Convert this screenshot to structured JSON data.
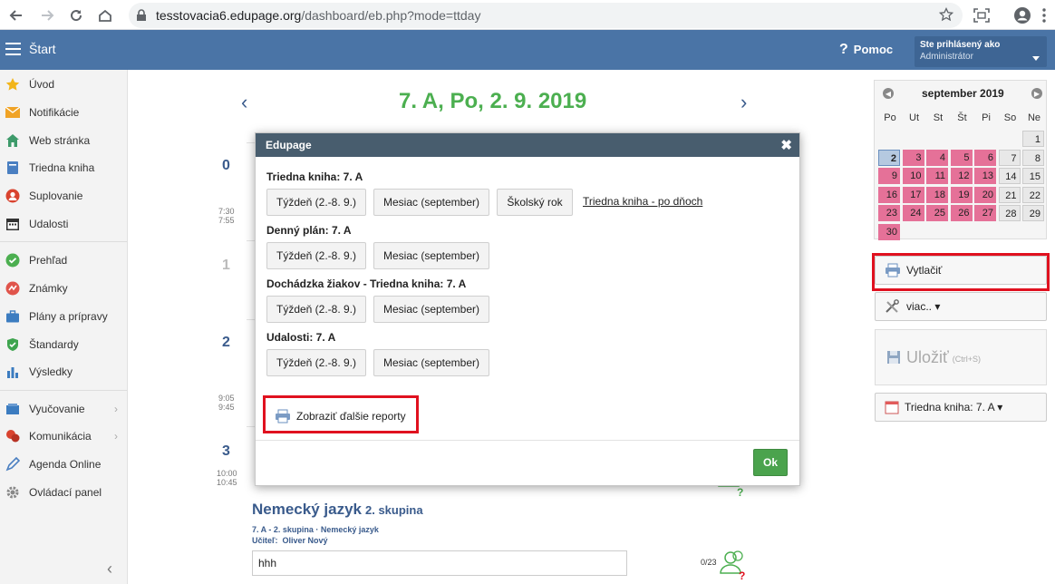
{
  "browser": {
    "url_host": "tesstovacia6.edupage.org",
    "url_path": "/dashboard/eb.php?mode=ttday"
  },
  "topbar": {
    "menu_label": "Štart",
    "help_label": "Pomoc",
    "user_caption": "Ste prihlásený ako",
    "user_name": "Administrátor"
  },
  "sidebar": {
    "items": [
      {
        "label": "Úvod",
        "icon": "star-icon"
      },
      {
        "label": "Notifikácie",
        "icon": "envelope-icon"
      },
      {
        "label": "Web stránka",
        "icon": "house-icon"
      },
      {
        "label": "Triedna kniha",
        "icon": "book-icon"
      },
      {
        "label": "Suplovanie",
        "icon": "person-icon"
      },
      {
        "label": "Udalosti",
        "icon": "calendar-icon"
      },
      {
        "label": "Prehľad",
        "icon": "check-circle-icon"
      },
      {
        "label": "Známky",
        "icon": "grades-icon"
      },
      {
        "label": "Plány a prípravy",
        "icon": "briefcase-icon"
      },
      {
        "label": "Štandardy",
        "icon": "shield-icon"
      },
      {
        "label": "Výsledky",
        "icon": "bar-chart-icon"
      },
      {
        "label": "Vyučovanie",
        "icon": "teaching-icon"
      },
      {
        "label": "Komunikácia",
        "icon": "chat-icon"
      },
      {
        "label": "Agenda Online",
        "icon": "pen-icon"
      },
      {
        "label": "Ovládací panel",
        "icon": "gear-icon"
      }
    ]
  },
  "main": {
    "date_title": "7. A, Po, 2. 9. 2019",
    "lessons": [
      {
        "num": "0",
        "time_start": "7:30",
        "time_end": "7:55"
      },
      {
        "num": "1",
        "time_start": "",
        "time_end": ""
      },
      {
        "num": "2",
        "time_start": "9:05",
        "time_end": "9:45"
      },
      {
        "num": "3",
        "time_start": "10:00",
        "time_end": "10:45"
      }
    ],
    "subject": "Nemecký jazyk",
    "subject_group": "2. skupina",
    "subject_detail": "7. A - 2. skupina · Nemecký jazyk",
    "teacher_label": "Učiteľ:",
    "teacher_name": "Oliver Nový",
    "topic_value": "hhh",
    "attendance_count": "0/23"
  },
  "calendar": {
    "month_label": "september 2019",
    "weekdays": [
      "Po",
      "Ut",
      "St",
      "Št",
      "Pi",
      "So",
      "Ne"
    ],
    "days": [
      "1",
      "2",
      "3",
      "4",
      "5",
      "6",
      "7",
      "8",
      "9",
      "10",
      "11",
      "12",
      "13",
      "14",
      "15",
      "16",
      "17",
      "18",
      "19",
      "20",
      "21",
      "22",
      "23",
      "24",
      "25",
      "26",
      "27",
      "28",
      "29",
      "30"
    ]
  },
  "right_panel": {
    "print_label": "Vytlačiť",
    "more_label": "viac.. ▾",
    "save_label": "Uložiť",
    "save_hint": "(Ctrl+S)",
    "class_book_label": "Triedna kniha: 7. A ▾"
  },
  "modal": {
    "title": "Edupage",
    "sections": [
      {
        "title": "Triedna kniha: 7. A",
        "buttons": [
          "Týždeň (2.-8. 9.)",
          "Mesiac (september)",
          "Školský rok"
        ],
        "link": "Triedna kniha - po dňoch"
      },
      {
        "title": "Denný plán: 7. A",
        "buttons": [
          "Týždeň (2.-8. 9.)",
          "Mesiac (september)"
        ]
      },
      {
        "title": "Dochádzka žiakov - Triedna kniha: 7. A",
        "buttons": [
          "Týždeň (2.-8. 9.)",
          "Mesiac (september)"
        ]
      },
      {
        "title": "Udalosti: 7. A",
        "buttons": [
          "Týždeň (2.-8. 9.)",
          "Mesiac (september)"
        ]
      }
    ],
    "more_reports_label": "Zobraziť ďalšie reporty",
    "ok_label": "Ok"
  },
  "colors": {
    "topbar": "#4a74a6",
    "date_title": "#4caf50",
    "highlight_frame": "#e0111f",
    "calendar_pink": "#e57198",
    "ok_button": "#4ba34d"
  }
}
